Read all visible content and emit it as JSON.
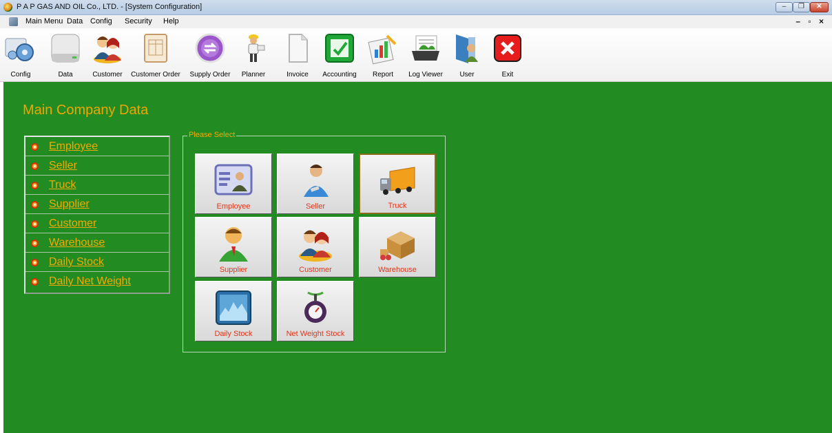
{
  "window": {
    "title": "P A P GAS AND OIL Co., LTD. - [System Configuration]",
    "controls": {
      "minimize": "‒",
      "maximize": "❐",
      "close": "✕"
    }
  },
  "menubar": {
    "items": [
      {
        "label": "Main Menu"
      },
      {
        "label": "Data"
      },
      {
        "label": "Config"
      },
      {
        "label": "Security"
      },
      {
        "label": "Help"
      }
    ],
    "mdi_controls": "– ▫ ×"
  },
  "toolbar": {
    "buttons": [
      {
        "label": "Config",
        "icon": "gear-icon"
      },
      {
        "label": "Data",
        "icon": "hard-drive-icon"
      },
      {
        "label": "Customer",
        "icon": "customer-people-icon"
      },
      {
        "label": "Customer Order",
        "icon": "order-form-icon"
      },
      {
        "label": "Supply Order",
        "icon": "purple-exchange-icon"
      },
      {
        "label": "Planner",
        "icon": "worker-icon"
      },
      {
        "label": "Invoice",
        "icon": "document-icon"
      },
      {
        "label": "Accounting",
        "icon": "green-check-icon"
      },
      {
        "label": "Report",
        "icon": "report-chart-icon"
      },
      {
        "label": "Log Viewer",
        "icon": "log-tray-icon"
      },
      {
        "label": "User",
        "icon": "user-door-icon"
      },
      {
        "label": "Exit",
        "icon": "red-x-icon"
      }
    ]
  },
  "main": {
    "heading": "Main Company Data",
    "side_menu": [
      {
        "label": "Employee"
      },
      {
        "label": "Seller"
      },
      {
        "label": "Truck"
      },
      {
        "label": "Supplier"
      },
      {
        "label": "Customer"
      },
      {
        "label": "Warehouse"
      },
      {
        "label": "Daily Stock"
      },
      {
        "label": "Daily Net Weight"
      }
    ],
    "group_legend": "Please Select",
    "tiles": [
      {
        "label": "Employee",
        "icon": "id-card-icon"
      },
      {
        "label": "Seller",
        "icon": "seller-person-icon"
      },
      {
        "label": "Truck",
        "icon": "truck-icon"
      },
      {
        "label": "Supplier",
        "icon": "supplier-person-icon"
      },
      {
        "label": "Customer",
        "icon": "customer-people-icon"
      },
      {
        "label": "Warehouse",
        "icon": "warehouse-boxes-icon"
      },
      {
        "label": "Daily Stock",
        "icon": "stock-chart-icon"
      },
      {
        "label": "Net Weight Stock",
        "icon": "scale-icon"
      }
    ]
  },
  "colors": {
    "content_bg": "#228b22",
    "heading": "#f0a500",
    "tile_label": "#e0361b"
  }
}
